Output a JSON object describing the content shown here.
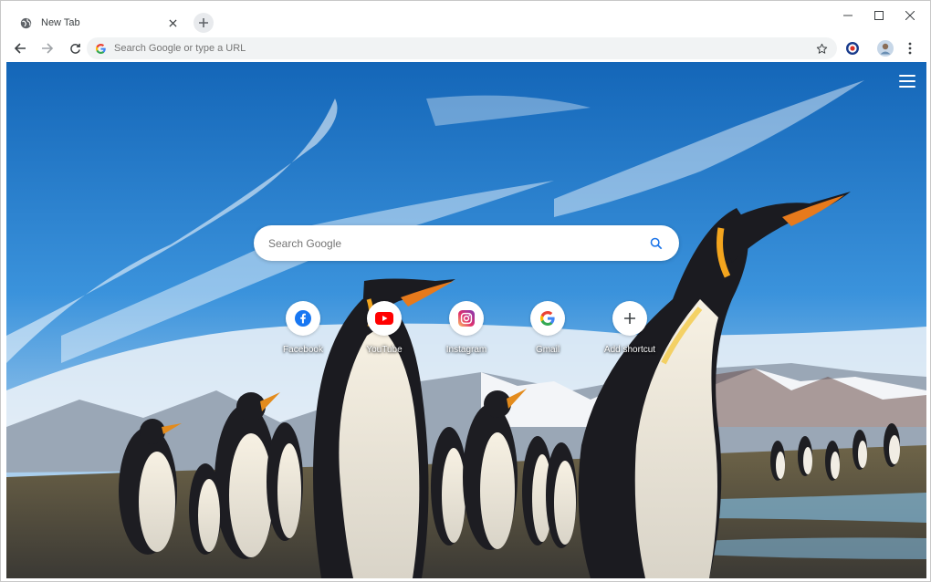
{
  "tab": {
    "title": "New Tab",
    "favicon": "globe-icon"
  },
  "toolbar": {
    "omnibox_placeholder": "Search Google or type a URL",
    "omnibox_value": ""
  },
  "ntp": {
    "search_placeholder": "Search Google",
    "shortcuts": [
      {
        "label": "Facebook",
        "icon": "facebook-icon",
        "color": "#1877f2"
      },
      {
        "label": "YouTube",
        "icon": "youtube-icon",
        "color": "#ff0000"
      },
      {
        "label": "Instagram",
        "icon": "instagram-icon",
        "color": "#c13584"
      },
      {
        "label": "Gmail",
        "icon": "google-g-icon",
        "color": "#4285f4"
      },
      {
        "label": "Add shortcut",
        "icon": "plus-icon",
        "color": "#3c4043"
      }
    ]
  },
  "colors": {
    "sky": "#2f86d6",
    "omnibox_bg": "#f1f3f4",
    "accent_blue": "#1a73e8"
  }
}
